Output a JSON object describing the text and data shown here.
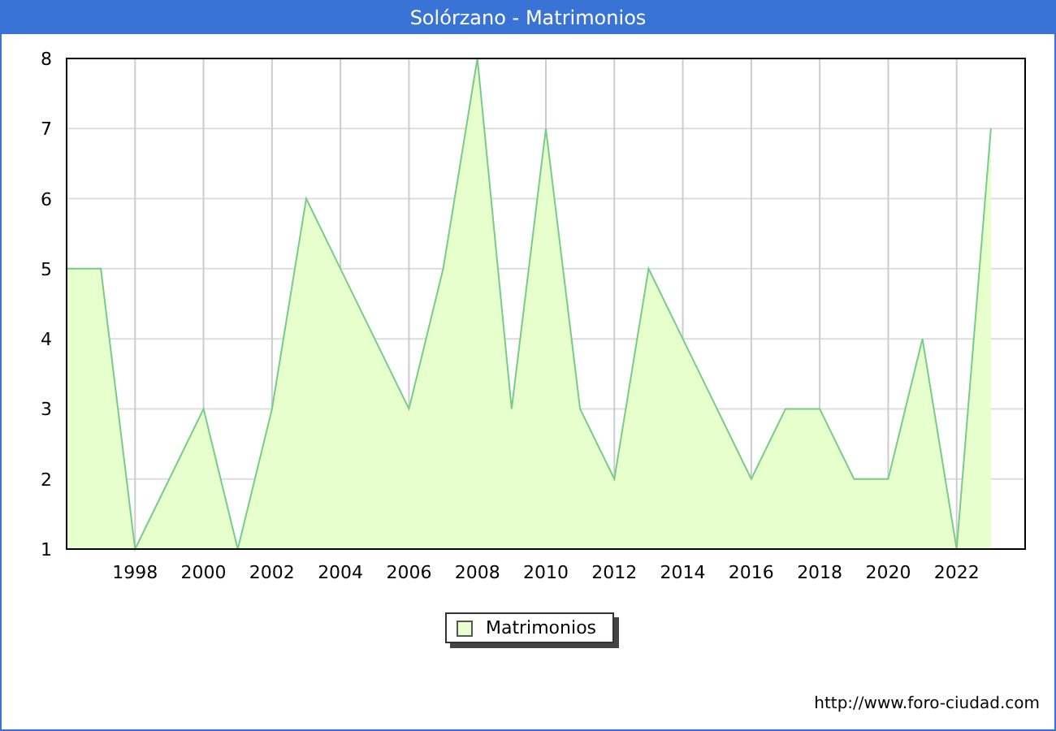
{
  "window": {
    "title": "Solórzano - Matrimonios"
  },
  "chart": {
    "chart_data": {
      "type": "area",
      "x": [
        1996,
        1997,
        1998,
        1999,
        2000,
        2001,
        2002,
        2003,
        2004,
        2005,
        2006,
        2007,
        2008,
        2009,
        2010,
        2011,
        2012,
        2013,
        2014,
        2015,
        2016,
        2017,
        2018,
        2019,
        2020,
        2021,
        2022,
        2023
      ],
      "series": [
        {
          "name": "Matrimonios",
          "color": "#e6ffcc",
          "values": [
            5,
            5,
            1,
            2,
            3,
            1,
            3,
            6,
            5,
            4,
            3,
            5,
            8,
            3,
            7,
            3,
            2,
            5,
            4,
            3,
            2,
            3,
            3,
            2,
            2,
            4,
            1,
            7
          ]
        }
      ],
      "xlim": [
        1996,
        2024
      ],
      "ylim": [
        1,
        8
      ],
      "xticks": [
        1998,
        2000,
        2002,
        2004,
        2006,
        2008,
        2010,
        2012,
        2014,
        2016,
        2018,
        2020,
        2022
      ],
      "yticks": [
        1,
        2,
        3,
        4,
        5,
        6,
        7,
        8
      ],
      "grid": true
    }
  },
  "footer": {
    "url": "http://www.foro-ciudad.com"
  }
}
